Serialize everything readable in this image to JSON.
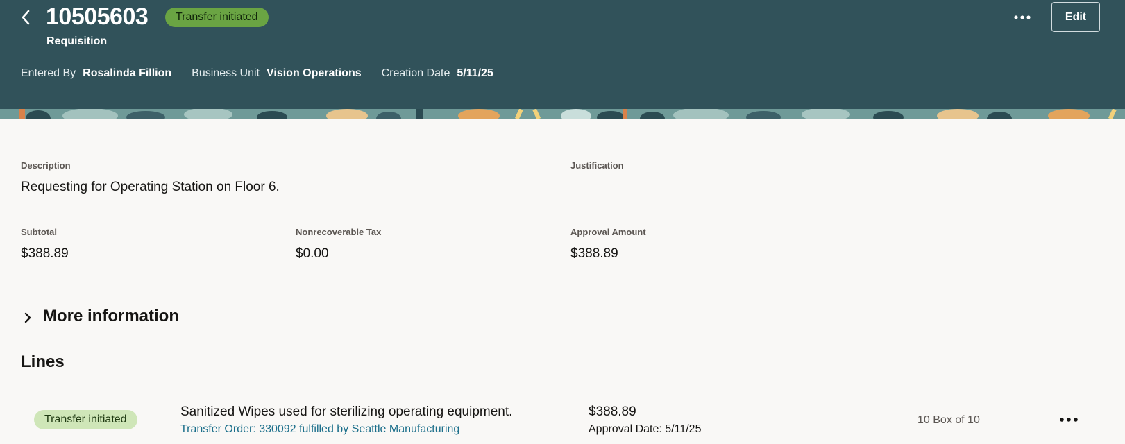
{
  "header": {
    "requisition_number": "10505603",
    "status": "Transfer initiated",
    "type": "Requisition",
    "meta": [
      {
        "label": "Entered By",
        "value": "Rosalinda Fillion"
      },
      {
        "label": "Business Unit",
        "value": "Vision Operations"
      },
      {
        "label": "Creation Date",
        "value": "5/11/25"
      }
    ],
    "edit_label": "Edit",
    "icons": {
      "back": "chevron-left-icon",
      "overflow": "more-horizontal-icon"
    },
    "colors": {
      "background": "#31525a",
      "status_pill": "#6aa443"
    }
  },
  "details": {
    "description": {
      "label": "Description",
      "value": "Requesting for Operating Station on Floor 6."
    },
    "justification": {
      "label": "Justification",
      "value": ""
    },
    "subtotal": {
      "label": "Subtotal",
      "value": "$388.89"
    },
    "nonrecoverable_tax": {
      "label": "Nonrecoverable Tax",
      "value": "$0.00"
    },
    "approval_amount": {
      "label": "Approval Amount",
      "value": "$388.89"
    }
  },
  "more_information": {
    "label": "More information",
    "icon": "chevron-right-icon"
  },
  "lines": {
    "title": "Lines",
    "items": [
      {
        "status": "Transfer initiated",
        "description": "Sanitized Wipes used for sterilizing operating equipment.",
        "link": "Transfer Order: 330092 fulfilled by Seattle Manufacturing",
        "amount": "$388.89",
        "approval_date": "Approval Date: 5/11/25",
        "quantity": "10 Box of 10",
        "actions_icon": "more-horizontal-icon"
      }
    ]
  },
  "colors": {
    "page_background": "#f9f8f6",
    "link": "#1a6e8a",
    "line_status_pill": "#cfe6b8"
  }
}
